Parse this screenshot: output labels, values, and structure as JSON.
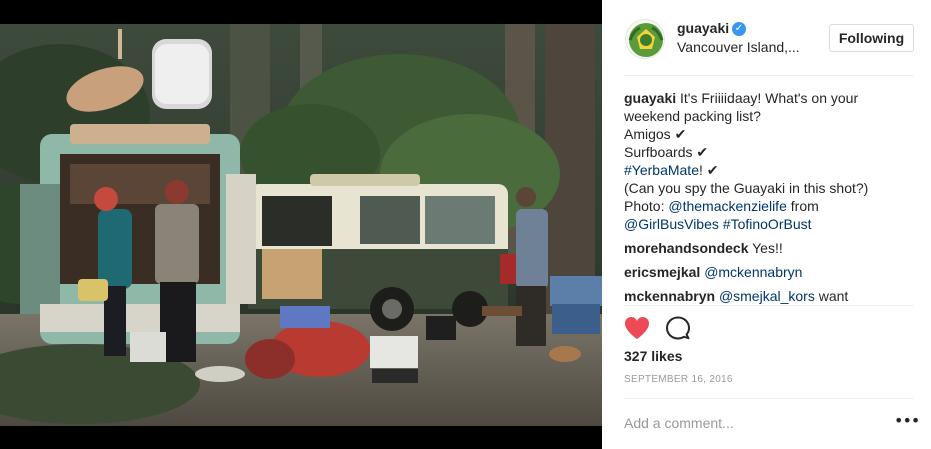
{
  "post": {
    "photo_alt": "",
    "username": "guayaki",
    "verified": true,
    "location": "Vancouver Island,...",
    "follow_button": "Following"
  },
  "caption": {
    "username": "guayaki",
    "line1": " It's Friiiidaay! What's on your",
    "line2": "weekend packing list?",
    "line3": "Amigos ✔",
    "line4": "Surfboards ✔",
    "hashtag_yerbamate": "#YerbaMate",
    "line5_suffix": "! ✔",
    "line6": "(Can you spy the Guayaki in this shot?)",
    "photo_prefix": "Photo: ",
    "mention_mackenzielife": "@themackenzielife",
    "photo_suffix": " from",
    "mention_girlbusvibes": "@GirlBusVibes",
    "hashtag_tofinoorbust": "#TofinoOrBust"
  },
  "comments": [
    {
      "username": "morehandsondeck",
      "text": " Yes!!"
    },
    {
      "username": "ericsmejkal",
      "mention": "@mckennabryn",
      "text": ""
    },
    {
      "username": "mckennabryn",
      "mention": "@smejkal_kors",
      "text": " want"
    }
  ],
  "likes": "327 likes",
  "date": "SEPTEMBER 16, 2016",
  "add_comment_placeholder": "Add a comment...",
  "more_options": "•••",
  "colors": {
    "heart": "#ed4956",
    "link": "#003569",
    "verified": "#3897f0",
    "muted": "#999999"
  },
  "icons": [
    "heart-icon",
    "comment-icon",
    "verified-icon",
    "more-options-icon"
  ]
}
